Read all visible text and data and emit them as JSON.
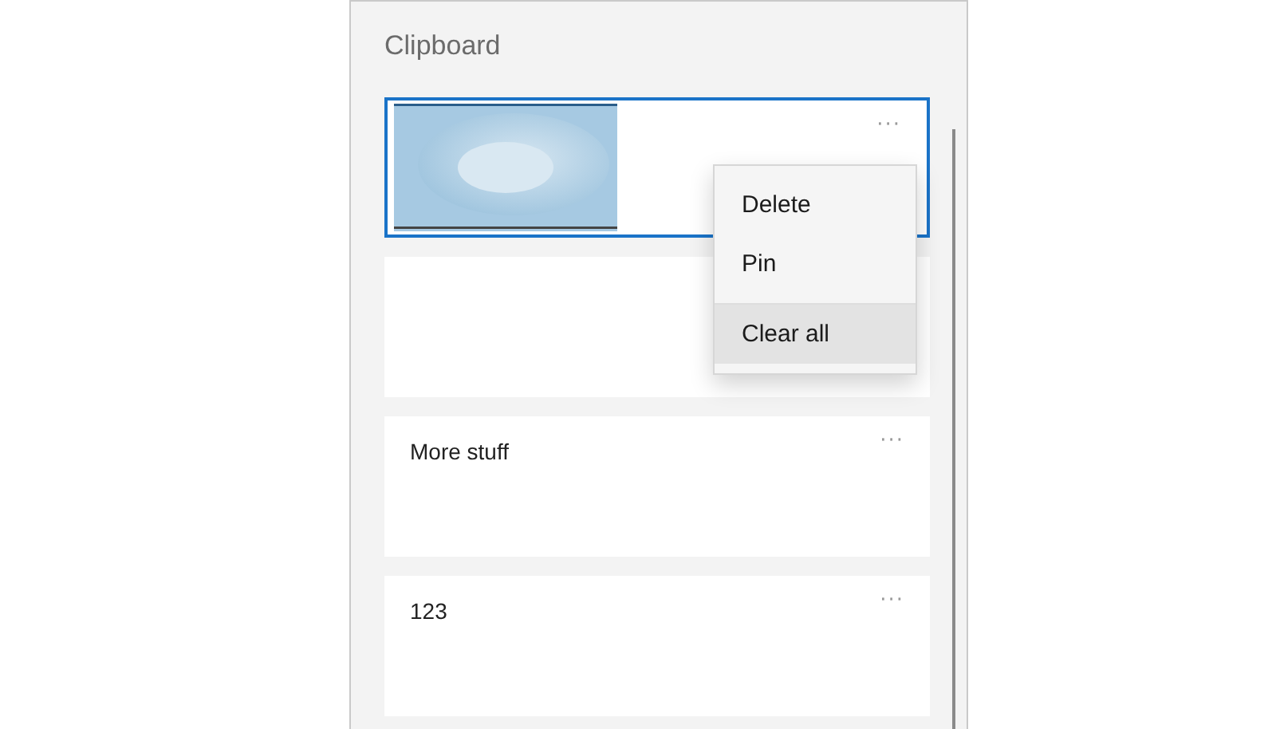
{
  "panel": {
    "title": "Clipboard"
  },
  "items": [
    {
      "kind": "picture",
      "selected": true,
      "more": "···"
    },
    {
      "kind": "blank",
      "selected": false
    },
    {
      "kind": "text",
      "selected": false,
      "more": "···",
      "text": "More stuff"
    },
    {
      "kind": "text",
      "selected": false,
      "more": "···",
      "text": "123"
    }
  ],
  "context_menu": {
    "items": [
      {
        "label": "Delete",
        "selected": false
      },
      {
        "label": "Pin",
        "selected": false
      },
      {
        "label": "Clear all",
        "selected": true
      }
    ]
  }
}
